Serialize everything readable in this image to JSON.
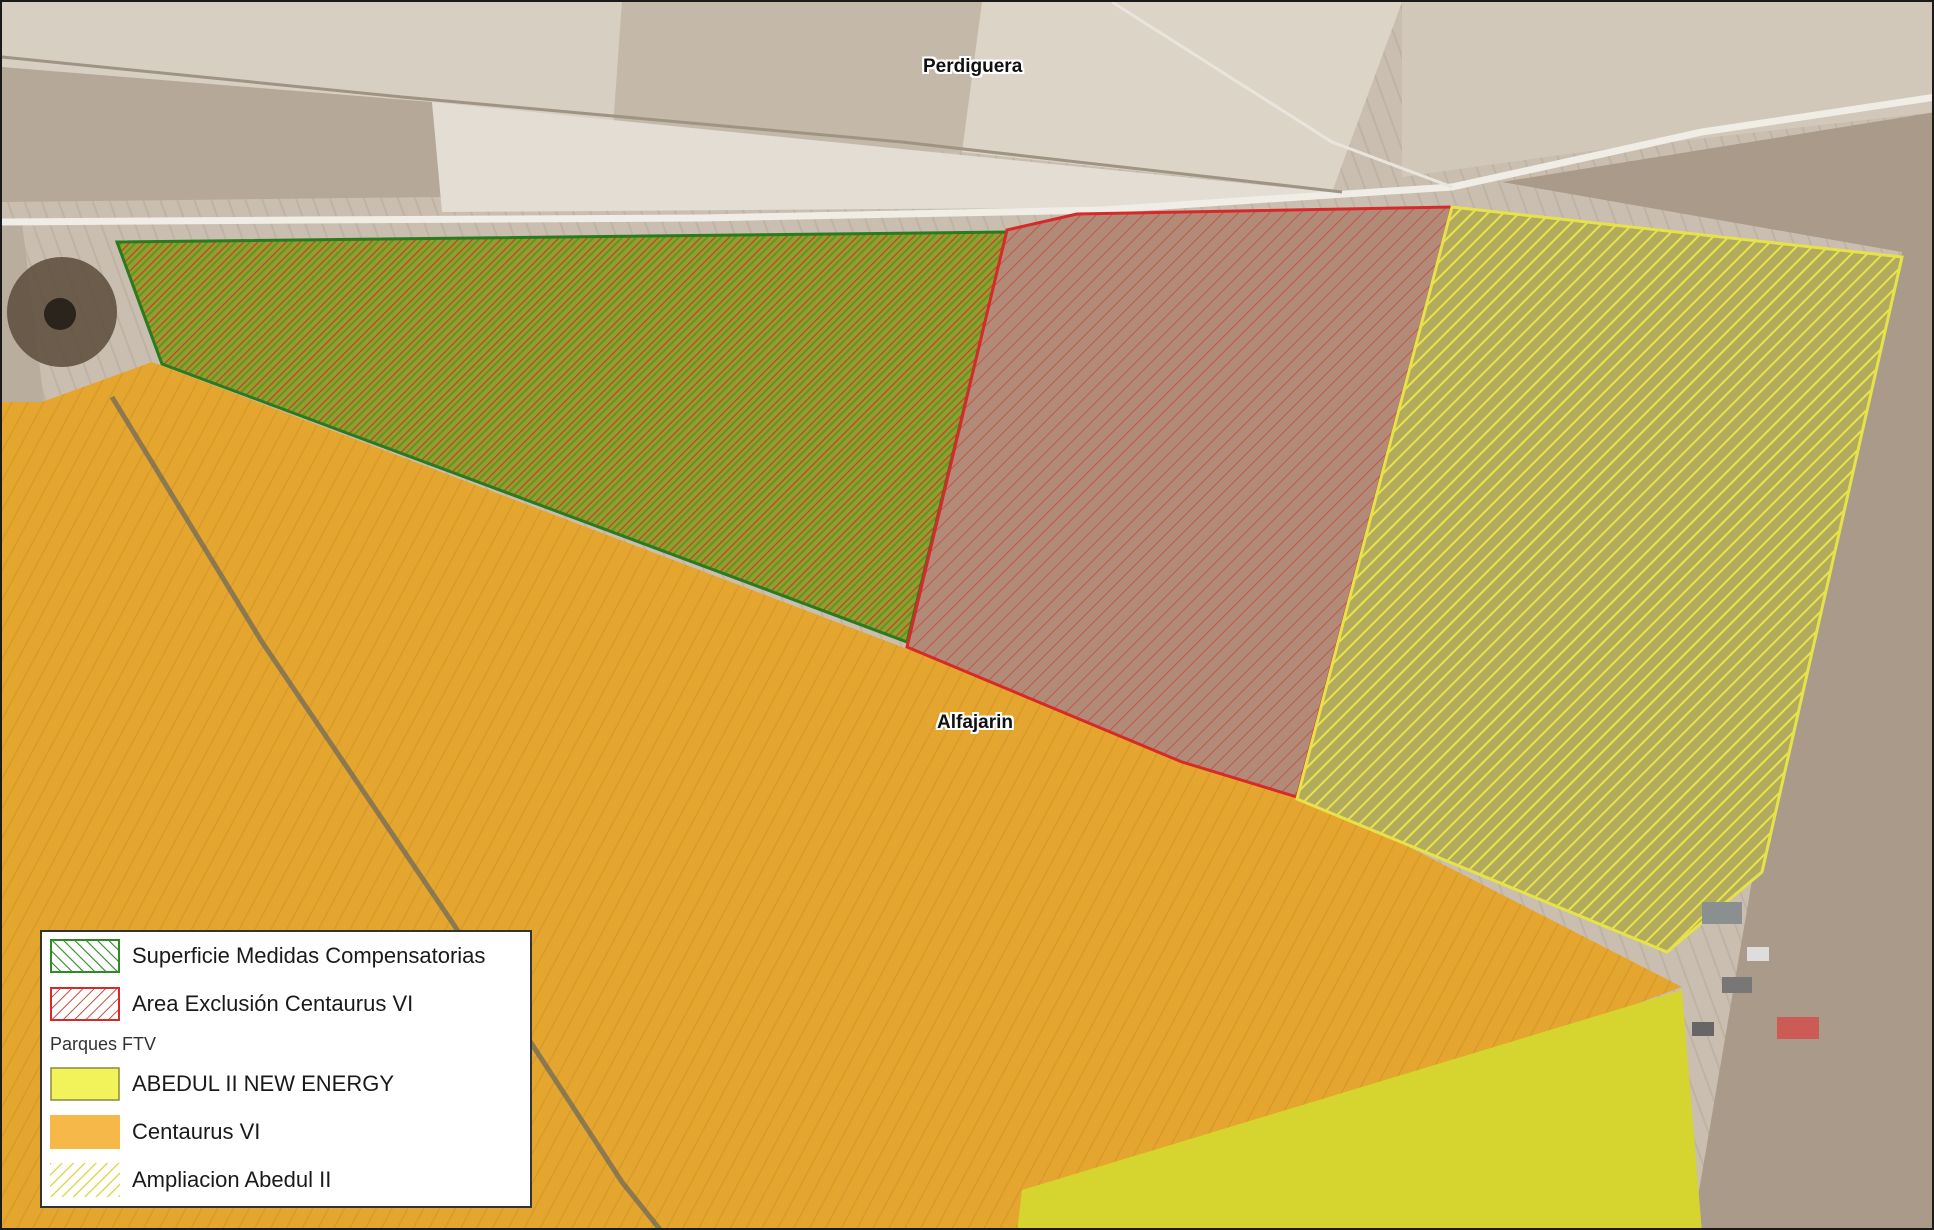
{
  "map": {
    "places": {
      "perdiguera": "Perdiguera",
      "alfajarin": "Alfajarin"
    }
  },
  "legend": {
    "items": [
      {
        "label": "Superficie Medidas Compensatorias",
        "fill": "hatch",
        "color": "#2e8b22"
      },
      {
        "label": "Area Exclusión Centaurus VI",
        "fill": "hatch",
        "color": "#d62a2a"
      }
    ],
    "group_heading": "Parques FTV",
    "group_items": [
      {
        "label": "ABEDUL II NEW ENERGY",
        "fill": "solid",
        "color": "#f2f25a"
      },
      {
        "label": "Centaurus VI",
        "fill": "solid",
        "color": "#f7b84a"
      },
      {
        "label": "Ampliacion Abedul II",
        "fill": "hatch",
        "color": "#e8e84a"
      }
    ]
  },
  "colors": {
    "centaurus": "#e9a72a",
    "abedul_solid": "#d8d62c",
    "ampliacion_hatch": "#e6e24a",
    "compensatorias_edge": "#2a7a1e",
    "exclusion_edge": "#d62a2a"
  }
}
